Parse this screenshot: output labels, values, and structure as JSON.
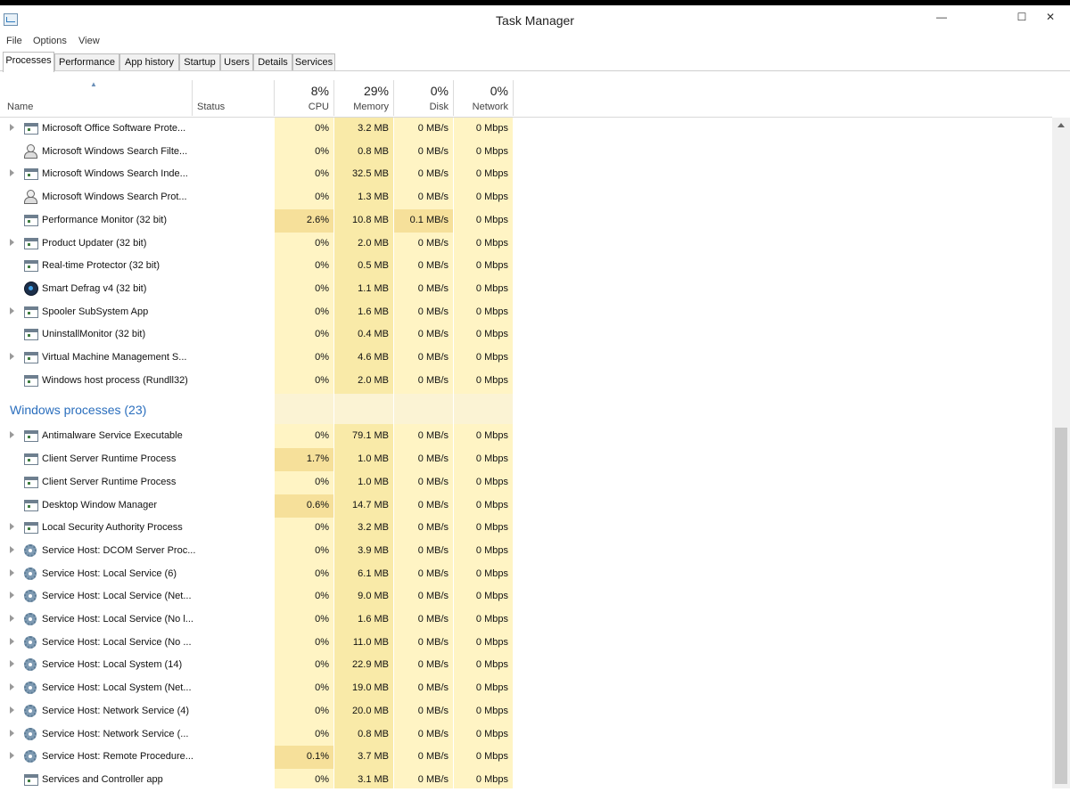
{
  "window": {
    "title": "Task Manager",
    "minimize": "—",
    "maximize": "☐",
    "close": "✕"
  },
  "menu": [
    "File",
    "Options",
    "View"
  ],
  "tabs": [
    "Processes",
    "Performance",
    "App history",
    "Startup",
    "Users",
    "Details",
    "Services"
  ],
  "header": {
    "name": "Name",
    "status": "Status",
    "cpu_pct": "8%",
    "cpu": "CPU",
    "mem_pct": "29%",
    "mem": "Memory",
    "disk_pct": "0%",
    "disk": "Disk",
    "net_pct": "0%",
    "net": "Network"
  },
  "background_processes": [
    {
      "name": "Microsoft Office Software Prote...",
      "icon": "window-icon",
      "expand": true,
      "cpu": "0%",
      "mem": "3.2 MB",
      "disk": "0 MB/s",
      "net": "0 Mbps"
    },
    {
      "name": "Microsoft Windows Search Filte...",
      "icon": "user-icon",
      "expand": false,
      "cpu": "0%",
      "mem": "0.8 MB",
      "disk": "0 MB/s",
      "net": "0 Mbps"
    },
    {
      "name": "Microsoft Windows Search Inde...",
      "icon": "window-icon",
      "expand": true,
      "cpu": "0%",
      "mem": "32.5 MB",
      "disk": "0 MB/s",
      "net": "0 Mbps"
    },
    {
      "name": "Microsoft Windows Search Prot...",
      "icon": "user-icon",
      "expand": false,
      "cpu": "0%",
      "mem": "1.3 MB",
      "disk": "0 MB/s",
      "net": "0 Mbps"
    },
    {
      "name": "Performance Monitor (32 bit)",
      "icon": "window-icon",
      "expand": false,
      "cpu": "2.6%",
      "mem": "10.8 MB",
      "disk": "0.1 MB/s",
      "net": "0 Mbps"
    },
    {
      "name": "Product Updater (32 bit)",
      "icon": "window-icon",
      "expand": true,
      "cpu": "0%",
      "mem": "2.0 MB",
      "disk": "0 MB/s",
      "net": "0 Mbps"
    },
    {
      "name": "Real-time Protector (32 bit)",
      "icon": "window-icon",
      "expand": false,
      "cpu": "0%",
      "mem": "0.5 MB",
      "disk": "0 MB/s",
      "net": "0 Mbps"
    },
    {
      "name": "Smart Defrag v4 (32 bit)",
      "icon": "disc-icon",
      "expand": false,
      "cpu": "0%",
      "mem": "1.1 MB",
      "disk": "0 MB/s",
      "net": "0 Mbps"
    },
    {
      "name": "Spooler SubSystem App",
      "icon": "window-icon",
      "expand": true,
      "cpu": "0%",
      "mem": "1.6 MB",
      "disk": "0 MB/s",
      "net": "0 Mbps"
    },
    {
      "name": "UninstallMonitor (32 bit)",
      "icon": "window-icon",
      "expand": false,
      "cpu": "0%",
      "mem": "0.4 MB",
      "disk": "0 MB/s",
      "net": "0 Mbps"
    },
    {
      "name": "Virtual Machine Management S...",
      "icon": "window-icon",
      "expand": true,
      "cpu": "0%",
      "mem": "4.6 MB",
      "disk": "0 MB/s",
      "net": "0 Mbps"
    },
    {
      "name": "Windows host process (Rundll32)",
      "icon": "window-icon",
      "expand": false,
      "cpu": "0%",
      "mem": "2.0 MB",
      "disk": "0 MB/s",
      "net": "0 Mbps"
    }
  ],
  "windows_group": {
    "title": "Windows processes (23)"
  },
  "windows_processes": [
    {
      "name": "Antimalware Service Executable",
      "icon": "window-icon",
      "expand": true,
      "cpu": "0%",
      "mem": "79.1 MB",
      "disk": "0 MB/s",
      "net": "0 Mbps"
    },
    {
      "name": "Client Server Runtime Process",
      "icon": "window-icon",
      "expand": false,
      "cpu": "1.7%",
      "mem": "1.0 MB",
      "disk": "0 MB/s",
      "net": "0 Mbps"
    },
    {
      "name": "Client Server Runtime Process",
      "icon": "window-icon",
      "expand": false,
      "cpu": "0%",
      "mem": "1.0 MB",
      "disk": "0 MB/s",
      "net": "0 Mbps"
    },
    {
      "name": "Desktop Window Manager",
      "icon": "window-icon",
      "expand": false,
      "cpu": "0.6%",
      "mem": "14.7 MB",
      "disk": "0 MB/s",
      "net": "0 Mbps"
    },
    {
      "name": "Local Security Authority Process",
      "icon": "window-icon",
      "expand": true,
      "cpu": "0%",
      "mem": "3.2 MB",
      "disk": "0 MB/s",
      "net": "0 Mbps"
    },
    {
      "name": "Service Host: DCOM Server Proc...",
      "icon": "gear-icon",
      "expand": true,
      "cpu": "0%",
      "mem": "3.9 MB",
      "disk": "0 MB/s",
      "net": "0 Mbps"
    },
    {
      "name": "Service Host: Local Service (6)",
      "icon": "gear-icon",
      "expand": true,
      "cpu": "0%",
      "mem": "6.1 MB",
      "disk": "0 MB/s",
      "net": "0 Mbps"
    },
    {
      "name": "Service Host: Local Service (Net...",
      "icon": "gear-icon",
      "expand": true,
      "cpu": "0%",
      "mem": "9.0 MB",
      "disk": "0 MB/s",
      "net": "0 Mbps"
    },
    {
      "name": "Service Host: Local Service (No l...",
      "icon": "gear-icon",
      "expand": true,
      "cpu": "0%",
      "mem": "1.6 MB",
      "disk": "0 MB/s",
      "net": "0 Mbps"
    },
    {
      "name": "Service Host: Local Service (No ...",
      "icon": "gear-icon",
      "expand": true,
      "cpu": "0%",
      "mem": "11.0 MB",
      "disk": "0 MB/s",
      "net": "0 Mbps"
    },
    {
      "name": "Service Host: Local System (14)",
      "icon": "gear-icon",
      "expand": true,
      "cpu": "0%",
      "mem": "22.9 MB",
      "disk": "0 MB/s",
      "net": "0 Mbps"
    },
    {
      "name": "Service Host: Local System (Net...",
      "icon": "gear-icon",
      "expand": true,
      "cpu": "0%",
      "mem": "19.0 MB",
      "disk": "0 MB/s",
      "net": "0 Mbps"
    },
    {
      "name": "Service Host: Network Service (4)",
      "icon": "gear-icon",
      "expand": true,
      "cpu": "0%",
      "mem": "20.0 MB",
      "disk": "0 MB/s",
      "net": "0 Mbps"
    },
    {
      "name": "Service Host: Network Service (...",
      "icon": "gear-icon",
      "expand": true,
      "cpu": "0%",
      "mem": "0.8 MB",
      "disk": "0 MB/s",
      "net": "0 Mbps"
    },
    {
      "name": "Service Host: Remote Procedure...",
      "icon": "gear-icon",
      "expand": true,
      "cpu": "0.1%",
      "mem": "3.7 MB",
      "disk": "0 MB/s",
      "net": "0 Mbps"
    },
    {
      "name": "Services and Controller app",
      "icon": "window-icon",
      "expand": false,
      "cpu": "0%",
      "mem": "3.1 MB",
      "disk": "0 MB/s",
      "net": "0 Mbps"
    }
  ],
  "colors": {
    "heat_light": "#fff4c4",
    "heat_medium": "#f9eaa8",
    "group_title": "#2a6ebd"
  }
}
